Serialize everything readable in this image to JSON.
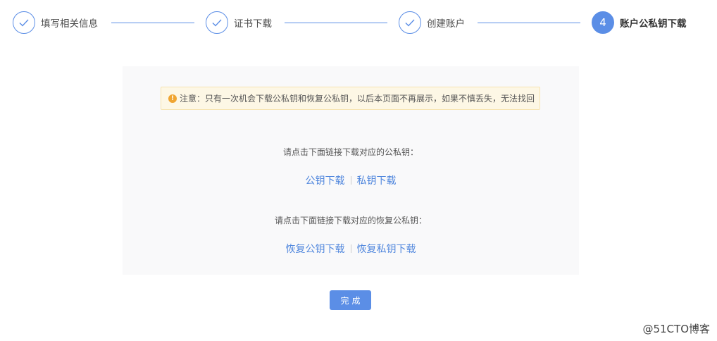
{
  "steps": [
    {
      "number": "",
      "label": "填写相关信息",
      "status": "done"
    },
    {
      "number": "",
      "label": "证书下载",
      "status": "done"
    },
    {
      "number": "",
      "label": "创建账户",
      "status": "done"
    },
    {
      "number": "4",
      "label": "账户公私钥下载",
      "status": "active"
    }
  ],
  "notice": {
    "icon": "warning-icon",
    "text": "注意：只有一次机会下载公私钥和恢复公私钥，以后本页面不再展示，如果不慎丢失，无法找回"
  },
  "download": {
    "prompt": "请点击下面链接下载对应的公私钥：",
    "public_key_link": "公钥下载",
    "private_key_link": "私钥下载"
  },
  "recovery": {
    "prompt": "请点击下面链接下载对应的恢复公私钥：",
    "public_key_link": "恢复公钥下载",
    "private_key_link": "恢复私钥下载"
  },
  "actions": {
    "done_label": "完成"
  },
  "watermark": "@51CTO博客",
  "colors": {
    "primary": "#5b8ee6",
    "link": "#4f86dd",
    "notice_bg": "#fdf7e5",
    "warning": "#f0a531"
  }
}
